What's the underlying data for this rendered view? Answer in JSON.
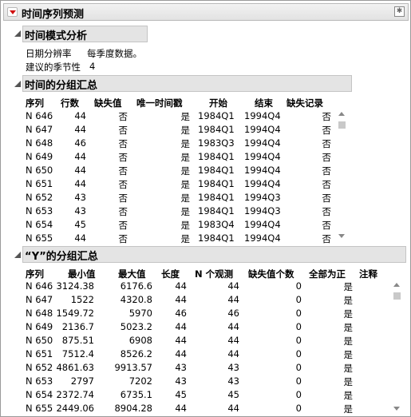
{
  "report": {
    "title": "时间序列预测"
  },
  "mode": {
    "title": "时间模式分析",
    "rate_label": "日期分辨率",
    "rate_value": "每季度数据。",
    "season_label": "建议的季节性",
    "season_value": "4"
  },
  "group_summary": {
    "title": "时间的分组汇总",
    "columns": [
      "序列",
      "行数",
      "缺失值",
      "唯一时间戳",
      "开始",
      "结束",
      "缺失记录"
    ],
    "rows": [
      [
        "N 646",
        "44",
        "否",
        "是",
        "1984Q1",
        "1994Q4",
        "否"
      ],
      [
        "N 647",
        "44",
        "否",
        "是",
        "1984Q1",
        "1994Q4",
        "否"
      ],
      [
        "N 648",
        "46",
        "否",
        "是",
        "1983Q3",
        "1994Q4",
        "否"
      ],
      [
        "N 649",
        "44",
        "否",
        "是",
        "1984Q1",
        "1994Q4",
        "否"
      ],
      [
        "N 650",
        "44",
        "否",
        "是",
        "1984Q1",
        "1994Q4",
        "否"
      ],
      [
        "N 651",
        "44",
        "否",
        "是",
        "1984Q1",
        "1994Q4",
        "否"
      ],
      [
        "N 652",
        "43",
        "否",
        "是",
        "1984Q1",
        "1994Q3",
        "否"
      ],
      [
        "N 653",
        "43",
        "否",
        "是",
        "1984Q1",
        "1994Q3",
        "否"
      ],
      [
        "N 654",
        "45",
        "否",
        "是",
        "1983Q4",
        "1994Q4",
        "否"
      ],
      [
        "N 655",
        "44",
        "否",
        "是",
        "1984Q1",
        "1994Q4",
        "否"
      ]
    ]
  },
  "y_summary": {
    "title": "“Y”的分组汇总",
    "columns": [
      "序列",
      "最小值",
      "最大值",
      "长度",
      "N 个观测",
      "缺失值个数",
      "全部为正",
      "注释"
    ],
    "rows": [
      [
        "N 646",
        "3124.38",
        "6176.6",
        "44",
        "44",
        "0",
        "是",
        ""
      ],
      [
        "N 647",
        "1522",
        "4320.8",
        "44",
        "44",
        "0",
        "是",
        ""
      ],
      [
        "N 648",
        "1549.72",
        "5970",
        "46",
        "46",
        "0",
        "是",
        ""
      ],
      [
        "N 649",
        "2136.7",
        "5023.2",
        "44",
        "44",
        "0",
        "是",
        ""
      ],
      [
        "N 650",
        "875.51",
        "6908",
        "44",
        "44",
        "0",
        "是",
        ""
      ],
      [
        "N 651",
        "7512.4",
        "8526.2",
        "44",
        "44",
        "0",
        "是",
        ""
      ],
      [
        "N 652",
        "4861.63",
        "9913.57",
        "43",
        "43",
        "0",
        "是",
        ""
      ],
      [
        "N 653",
        "2797",
        "7202",
        "43",
        "43",
        "0",
        "是",
        ""
      ],
      [
        "N 654",
        "2372.74",
        "6735.1",
        "45",
        "45",
        "0",
        "是",
        ""
      ],
      [
        "N 655",
        "2449.06",
        "8904.28",
        "44",
        "44",
        "0",
        "是",
        ""
      ]
    ]
  }
}
